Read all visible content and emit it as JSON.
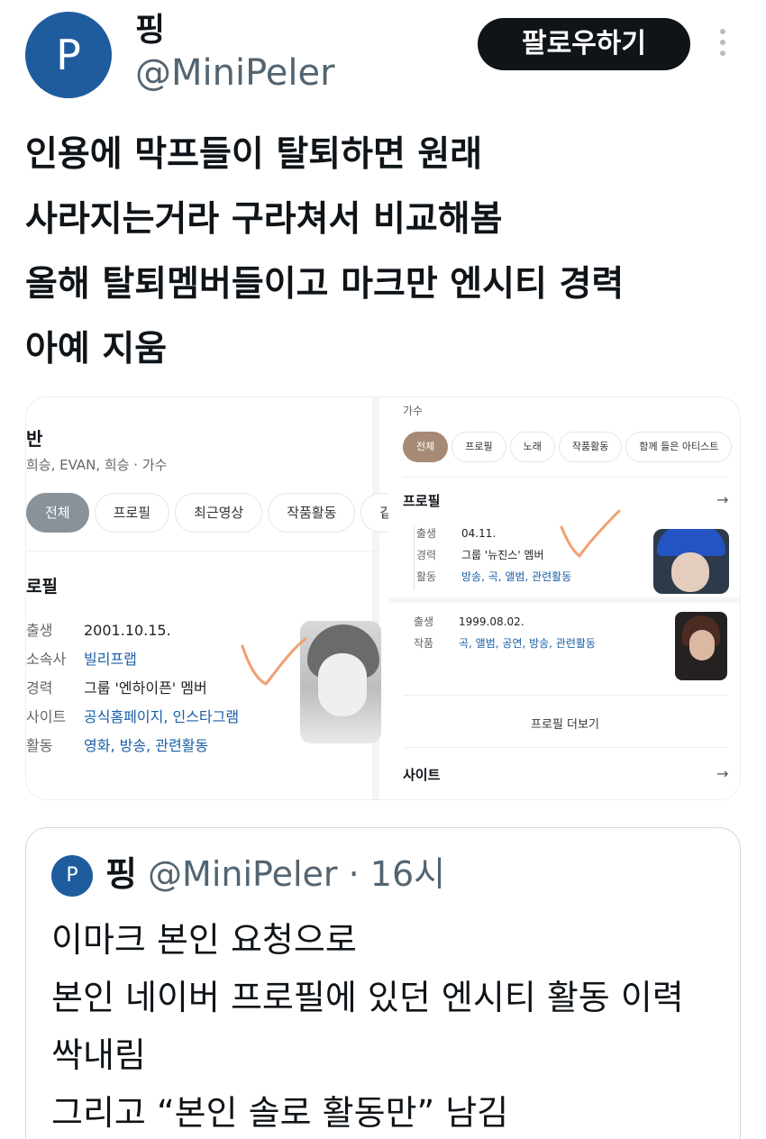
{
  "author": {
    "avatar_letter": "P",
    "name": "핑",
    "handle": "@MiniPeler",
    "avatar_color": "#1f5c9e"
  },
  "actions": {
    "follow_label": "팔로우하기",
    "more_icon": "more-vertical-icon"
  },
  "tweet": {
    "lines": [
      "인용에 막프들이 탈퇴하면 원래",
      "사라지는거라 구라쳐서 비교해봄",
      "올해 탈퇴멤버들이고 마크만 엔시티 경력",
      "아예 지움"
    ]
  },
  "media": {
    "left": {
      "name": "반",
      "aliases": "희승, EVAN, 희승 · 가수",
      "tabs": [
        "전체",
        "프로필",
        "최근영상",
        "작품활동",
        "같"
      ],
      "section": "로필",
      "rows": [
        {
          "k": "출생",
          "v": "2001.10.15."
        },
        {
          "k": "소속사",
          "v": "빌리프랩"
        },
        {
          "k": "경력",
          "v": "그룹 '엔하이픈' 멤버"
        },
        {
          "k": "사이트",
          "v": "공식홈페이지, 인스타그램"
        },
        {
          "k": "활동",
          "v": "영화, 방송, 관련활동"
        }
      ]
    },
    "right": {
      "category": "가수",
      "tabs": [
        "전체",
        "프로필",
        "노래",
        "작품활동",
        "함께 들은 아티스트"
      ],
      "section": "프로필",
      "arrow": "→",
      "rows_top": [
        {
          "k": "출생",
          "v": "04.11."
        },
        {
          "k": "경력",
          "v": "그룹 '뉴진스' 멤버"
        },
        {
          "k": "활동",
          "v": "방송, 곡, 앨범, 관련활동"
        }
      ],
      "rows_bottom": [
        {
          "k": "출생",
          "v": "1999.08.02."
        },
        {
          "k": "작품",
          "v": "곡, 앨범, 공연, 방송, 관련활동"
        }
      ],
      "more_label": "프로필 더보기",
      "site_label": "사이트",
      "site_arrow": "→"
    },
    "check_color": "#f0a070"
  },
  "quote": {
    "avatar_letter": "P",
    "name": "핑",
    "handle_time": " @MiniPeler · 16시",
    "lines": [
      "이마크 본인 요청으로",
      "본인 네이버 프로필에 있던 엔시티 활동 이력",
      "싹내림",
      "그리고 “본인 솔로 활동만” 남김"
    ]
  }
}
